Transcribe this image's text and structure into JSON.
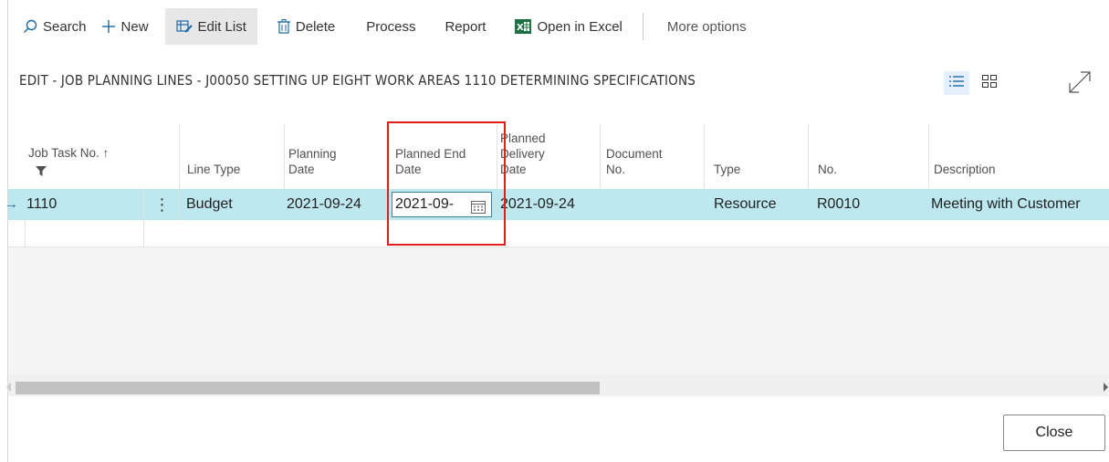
{
  "actionbar": {
    "search": "Search",
    "new": "New",
    "edit_list": "Edit List",
    "delete": "Delete",
    "process": "Process",
    "report": "Report",
    "open_in_excel": "Open in Excel",
    "more_options": "More options"
  },
  "page_title": "EDIT - JOB PLANNING LINES - J00050 SETTING UP EIGHT WORK AREAS 1110 DETERMINING SPECIFICATIONS",
  "columns": {
    "job_task_no": "Job Task No. ↑",
    "line_type": "Line Type",
    "planning_date_1": "Planning",
    "planning_date_2": "Date",
    "planned_end_1": "Planned End",
    "planned_end_2": "Date",
    "planned_delivery_1": "Planned",
    "planned_delivery_2": "Delivery",
    "planned_delivery_3": "Date",
    "document_no_1": "Document",
    "document_no_2": "No.",
    "type": "Type",
    "no": "No.",
    "description": "Description"
  },
  "rows": [
    {
      "job_task_no": "1110",
      "line_type": "Budget",
      "planning_date": "2021-09-24",
      "planned_end_date": "2021-09-",
      "planned_delivery_date": "2021-09-24",
      "document_no": "",
      "type": "Resource",
      "no": "R0010",
      "description": "Meeting with Customer"
    }
  ],
  "close_button": "Close",
  "colors": {
    "selected_row": "#bde8ef",
    "highlight_box": "#e02020",
    "input_border": "#3b7fa8",
    "excel_green": "#1e7145",
    "accent_blue": "#1a6aa6"
  }
}
